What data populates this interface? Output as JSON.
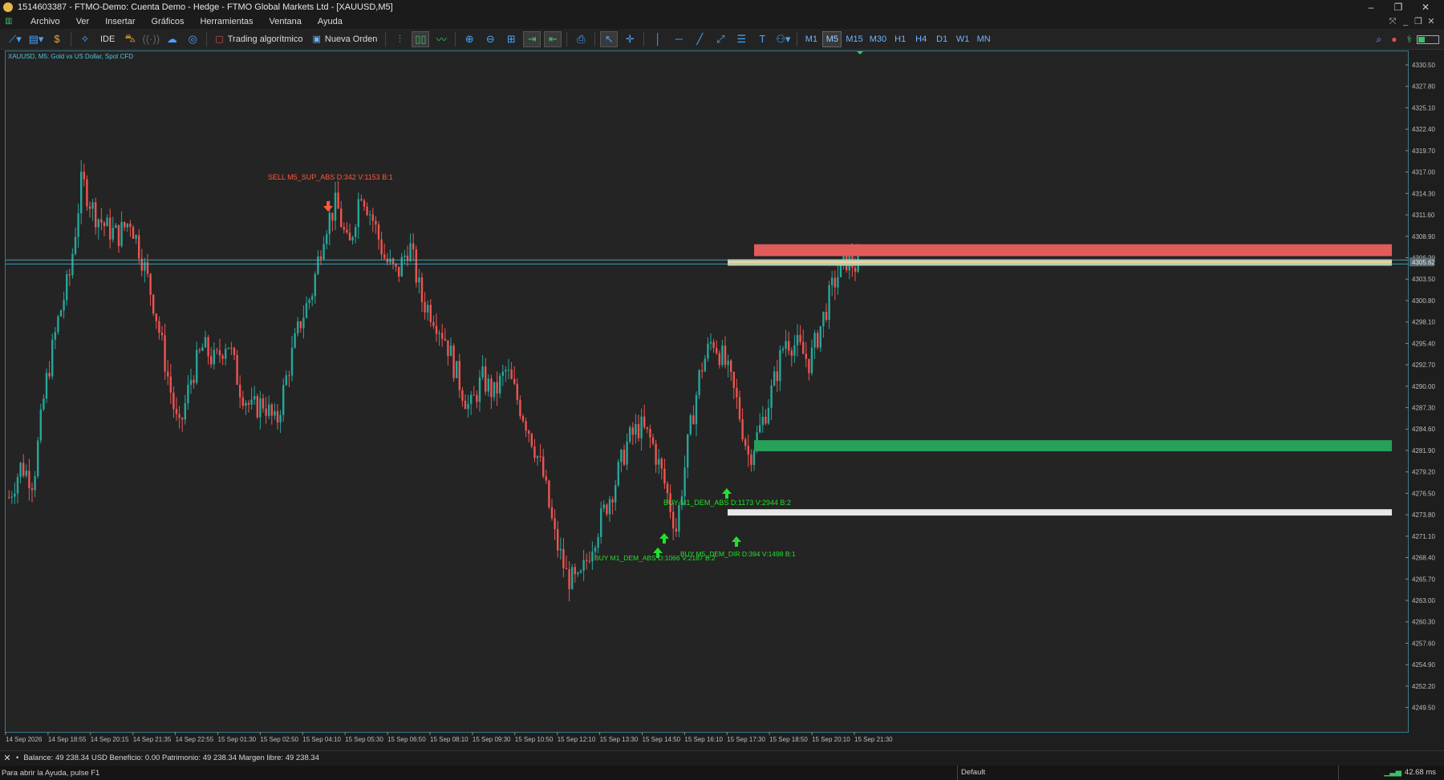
{
  "window": {
    "title": "1514603387 - FTMO-Demo: Cuenta Demo - Hedge - FTMO Global Markets Ltd - [XAUUSD,M5]"
  },
  "menu": [
    "Archivo",
    "Ver",
    "Insertar",
    "Gráficos",
    "Herramientas",
    "Ventana",
    "Ayuda"
  ],
  "toolbar": {
    "ide_label": "IDE",
    "algo_label": "Trading algorítmico",
    "order_label": "Nueva Orden",
    "timeframes": [
      "M1",
      "M5",
      "M15",
      "M30",
      "H1",
      "H4",
      "D1",
      "W1",
      "MN"
    ],
    "active_timeframe": "M5"
  },
  "chart": {
    "symbol_label": "XAUUSD, M5:  Gold vs US Dollar, Spot CFD",
    "current_price_label": "4305.62",
    "colors": {
      "bull": "#26a69a",
      "bear": "#ef5350",
      "resistance_zone": "#e15b5b",
      "supply_zone": "#e8d29a",
      "demand_zone": "#27a05a",
      "support_zone": "#e8e8e8",
      "sell_signal": "#ff5a3c",
      "buy_signal": "#22e02a"
    },
    "annotations": {
      "sell": "SELL M5_SUP_ABS D:342 V:1153 B:1",
      "buy1": "BUY M1_DEM_ABS D:1173 V:2944 B:2",
      "buy2": "BUY M1_DEM_ABS D:1066 V:2187 B:2",
      "buy3": "BUY M5_DEM_DIR D:394 V:1498 B:1"
    }
  },
  "chart_data": {
    "type": "candlestick",
    "title": "XAUUSD, M5:  Gold vs US Dollar, Spot CFD",
    "y_ticks": [
      "4330.50",
      "4327.80",
      "4325.10",
      "4322.40",
      "4319.70",
      "4317.00",
      "4314.30",
      "4311.60",
      "4308.90",
      "4306.20",
      "4303.50",
      "4300.80",
      "4298.10",
      "4295.40",
      "4292.70",
      "4290.00",
      "4287.30",
      "4284.60",
      "4281.90",
      "4279.20",
      "4276.50",
      "4273.80",
      "4271.10",
      "4268.40",
      "4265.70",
      "4263.00",
      "4260.30",
      "4257.60",
      "4254.90",
      "4252.20",
      "4249.50"
    ],
    "x_ticks": [
      "14 Sep 2026",
      "14 Sep 18:55",
      "14 Sep 20:15",
      "14 Sep 21:35",
      "14 Sep 22:55",
      "15 Sep 01:30",
      "15 Sep 02:50",
      "15 Sep 04:10",
      "15 Sep 05:30",
      "15 Sep 06:50",
      "15 Sep 08:10",
      "15 Sep 09:30",
      "15 Sep 10:50",
      "15 Sep 12:10",
      "15 Sep 13:30",
      "15 Sep 14:50",
      "15 Sep 16:10",
      "15 Sep 17:30",
      "15 Sep 18:50",
      "15 Sep 20:10",
      "15 Sep 21:30"
    ],
    "ylim": [
      4248.5,
      4332.0
    ],
    "close_path": [
      4276,
      4280,
      4278,
      4290,
      4298,
      4304,
      4316,
      4312,
      4310,
      4309,
      4311,
      4306,
      4300,
      4292,
      4284,
      4291,
      4295,
      4293,
      4296,
      4290,
      4287,
      4288,
      4285,
      4292,
      4298,
      4302,
      4310,
      4313,
      4307,
      4315,
      4311,
      4306,
      4304,
      4308,
      4301,
      4299,
      4296,
      4291,
      4287,
      4291,
      4289,
      4292,
      4288,
      4284,
      4279,
      4271,
      4266,
      4265,
      4270,
      4274,
      4278,
      4283,
      4285,
      4283,
      4278,
      4272,
      4283,
      4292,
      4296,
      4293,
      4288,
      4281,
      4285,
      4290,
      4296,
      4295,
      4293,
      4298,
      4303,
      4306,
      4305
    ],
    "current_price": 4305.62,
    "zones": [
      {
        "name": "resistance",
        "low": 4306.4,
        "high": 4307.9
      },
      {
        "name": "supply",
        "low": 4305.2,
        "high": 4306.0
      },
      {
        "name": "demand",
        "low": 4281.8,
        "high": 4283.2
      },
      {
        "name": "support",
        "low": 4273.7,
        "high": 4274.5
      }
    ]
  },
  "status": {
    "balance": "Balance: 49 238.34 USD  Beneficio: 0.00  Patrimonio: 49 238.34  Margen libre: 49 238.34"
  },
  "help": {
    "text": "Para abrir la Ayuda, pulse F1",
    "profile": "Default",
    "ping": "42.68 ms"
  }
}
